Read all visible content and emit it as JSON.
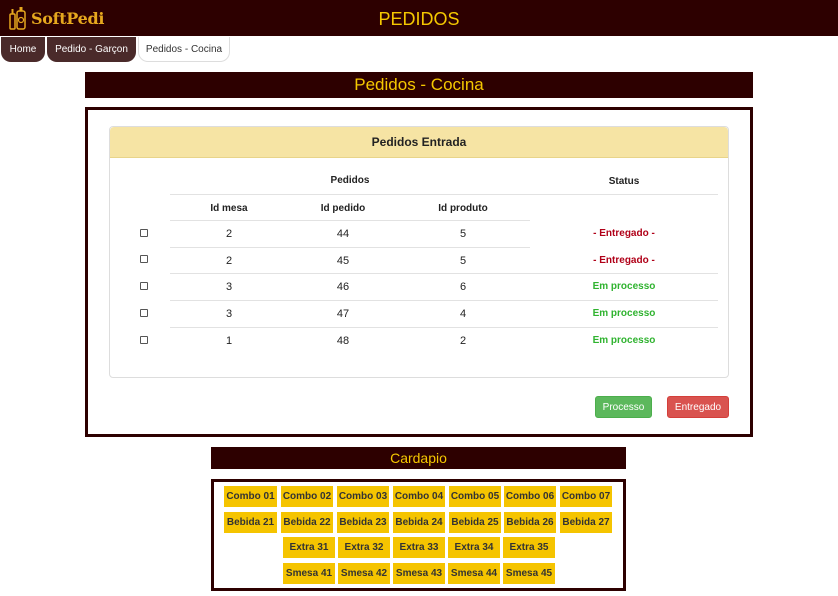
{
  "app": {
    "logo_text": "SoftPedi",
    "title": "PEDIDOS"
  },
  "breadcrumb": [
    "Home",
    "Pedido - Garçon",
    "Pedidos - Cocina"
  ],
  "page": {
    "banner": "Pedidos - Cocina"
  },
  "panel": {
    "title": "Pedidos Entrada",
    "group_header": "Pedidos",
    "status_header": "Status",
    "columns": [
      "Id mesa",
      "Id pedido",
      "Id produto"
    ],
    "rows": [
      {
        "mesa": "2",
        "pedido": "44",
        "produto": "5",
        "status": "- Entregado -",
        "status_color": "#b00018"
      },
      {
        "mesa": "2",
        "pedido": "45",
        "produto": "5",
        "status": "- Entregado -",
        "status_color": "#b00018"
      },
      {
        "mesa": "3",
        "pedido": "46",
        "produto": "6",
        "status": "Em processo",
        "status_color": "#2fb32f"
      },
      {
        "mesa": "3",
        "pedido": "47",
        "produto": "4",
        "status": "Em processo",
        "status_color": "#2fb32f"
      },
      {
        "mesa": "1",
        "pedido": "48",
        "produto": "2",
        "status": "Em processo",
        "status_color": "#2fb32f"
      }
    ]
  },
  "actions": {
    "process_label": "Processo",
    "deliver_label": "Entregado"
  },
  "cardapio": {
    "title": "Cardapio",
    "rows": [
      [
        "Combo 01",
        "Combo 02",
        "Combo 03",
        "Combo 04",
        "Combo 05",
        "Combo 06",
        "Combo 07"
      ],
      [
        "Bebida 21",
        "Bebida 22",
        "Bebida 23",
        "Bebida 24",
        "Bebida 25",
        "Bebida 26",
        "Bebida 27"
      ],
      [
        "Extra 31",
        "Extra 32",
        "Extra 33",
        "Extra 34",
        "Extra 35"
      ],
      [
        "Smesa 41",
        "Smesa 42",
        "Smesa 43",
        "Smesa 44",
        "Smesa 45"
      ]
    ]
  },
  "colors": {
    "brand_dark": "#2d0000",
    "accent_yellow": "#f5c800",
    "menu_yellow": "#f5c400"
  }
}
